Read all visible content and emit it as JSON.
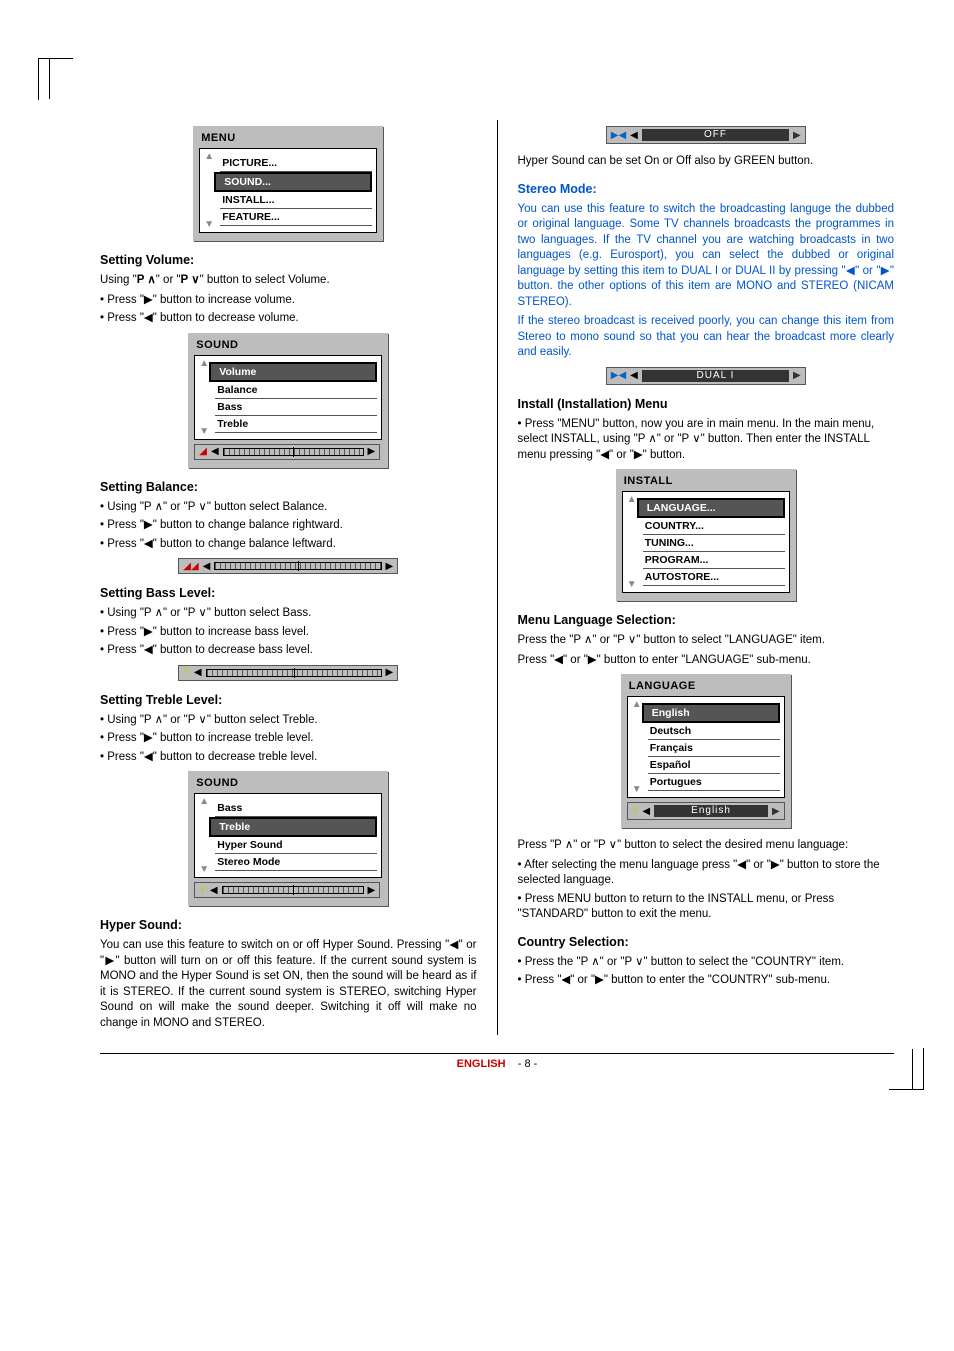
{
  "left": {
    "menu_fig": {
      "title": "MENU",
      "items": [
        "PICTURE...",
        "SOUND...",
        "INSTALL...",
        "FEATURE..."
      ],
      "selected": 1
    },
    "setting_volume": {
      "heading": "Setting Volume:",
      "line1_pre": "Using \"",
      "line1_mid": "\" or \"",
      "line1_post": "\" button to select Volume.",
      "b_inc": "Press \"▶\" button to increase volume.",
      "b_dec": "Press \"◀\" button to decrease volume."
    },
    "sound_fig": {
      "title": "SOUND",
      "items": [
        "Volume",
        "Balance",
        "Bass",
        "Treble"
      ],
      "selected": 0
    },
    "setting_balance": {
      "heading": "Setting Balance:",
      "b_sel": "Using \"P ∧\" or \"P ∨\" button select Balance.",
      "b_right": "Press \"▶\" button to change balance rightward.",
      "b_left": "Press \"◀\" button to change balance leftward."
    },
    "setting_bass": {
      "heading": "Setting Bass Level:",
      "b_sel": "Using \"P ∧\" or \"P ∨\" button select Bass.",
      "b_inc": "Press \"▶\" button to increase bass level.",
      "b_dec": "Press \"◀\" button to decrease bass level."
    },
    "setting_treble": {
      "heading": "Setting Treble Level:",
      "b_sel": "Using \"P ∧\" or \"P ∨\" button select Treble.",
      "b_inc": "Press \"▶\" button to increase treble level.",
      "b_dec": "Press \"◀\" button to decrease treble level."
    },
    "sound_fig2": {
      "title": "SOUND",
      "items": [
        "Bass",
        "Treble",
        "Hyper Sound",
        "Stereo Mode"
      ],
      "selected": 1
    },
    "hyper_sound": {
      "heading": "Hyper Sound:",
      "para": "You can use this feature to switch on or off Hyper Sound. Pressing \"◀\" or \"▶\" button will turn on or off this feature. If the current sound system is MONO and the Hyper Sound is set ON, then the sound will be heard as if it is STEREO. If the current sound system is STEREO, switching Hyper Sound on will make the sound deeper. Switching it off will make no change in MONO and STEREO."
    }
  },
  "right": {
    "off_bar": "OFF",
    "hyper_note": "Hyper Sound can be set On or Off also by GREEN button.",
    "stereo_mode": {
      "heading": "Stereo Mode:",
      "p1": "You can use this feature to switch the broadcasting languge the dubbed or original language. Some TV channels broadcasts the programmes in two languages. If the TV channel you are watching broadcasts in two languages (e.g. Eurosport), you can select the dubbed or original language by setting this item to DUAL I or DUAL II by pressing \"◀\" or \"▶\" button. the other options of this item are MONO and STEREO (NICAM STEREO).",
      "p2": "If the stereo broadcast is received poorly, you can change this item from Stereo to mono sound so that you can hear the broadcast more clearly and easily."
    },
    "dual_bar": "DUAL I",
    "install_heading": "Install (Installation) Menu",
    "install_bullet": "Press \"MENU\" button, now you are in main menu. In the main menu, select INSTALL, using \"P ∧\" or \"P ∨\" button. Then enter the INSTALL menu pressing \"◀\" or \"▶\" button.",
    "install_fig": {
      "title": "INSTALL",
      "items": [
        "LANGUAGE...",
        "COUNTRY...",
        "TUNING...",
        "PROGRAM...",
        "AUTOSTORE..."
      ],
      "selected": 0
    },
    "menu_lang": {
      "heading": "Menu Language Selection:",
      "p1": "Press the \"P ∧\" or \"P ∨\" button to select \"LANGUAGE\" item.",
      "p2": "Press \"◀\" or \"▶\" button to enter \"LANGUAGE\" sub-menu."
    },
    "lang_fig": {
      "title": "LANGUAGE",
      "items": [
        "English",
        "Deutsch",
        "Français",
        "Español",
        "Portugues"
      ],
      "selected": 0,
      "bar_value": "English"
    },
    "lang_after": {
      "p1": "Press \"P ∧\" or \"P ∨\" button to select the desired menu language:",
      "b1": "After selecting the menu language press \"◀\" or \"▶\" button to store the selected language.",
      "b2": "Press MENU button to return to the INSTALL menu, or Press \"STANDARD\" button to exit the menu."
    },
    "country": {
      "heading": "Country Selection:",
      "b1": "Press the \"P ∧\" or \"P ∨\" button to select the \"COUNTRY\" item.",
      "b2": "Press \"◀\" or \"▶\" button to enter the \"COUNTRY\" sub-menu."
    }
  },
  "footer": {
    "lang": "ENGLISH",
    "page": "- 8 -"
  }
}
